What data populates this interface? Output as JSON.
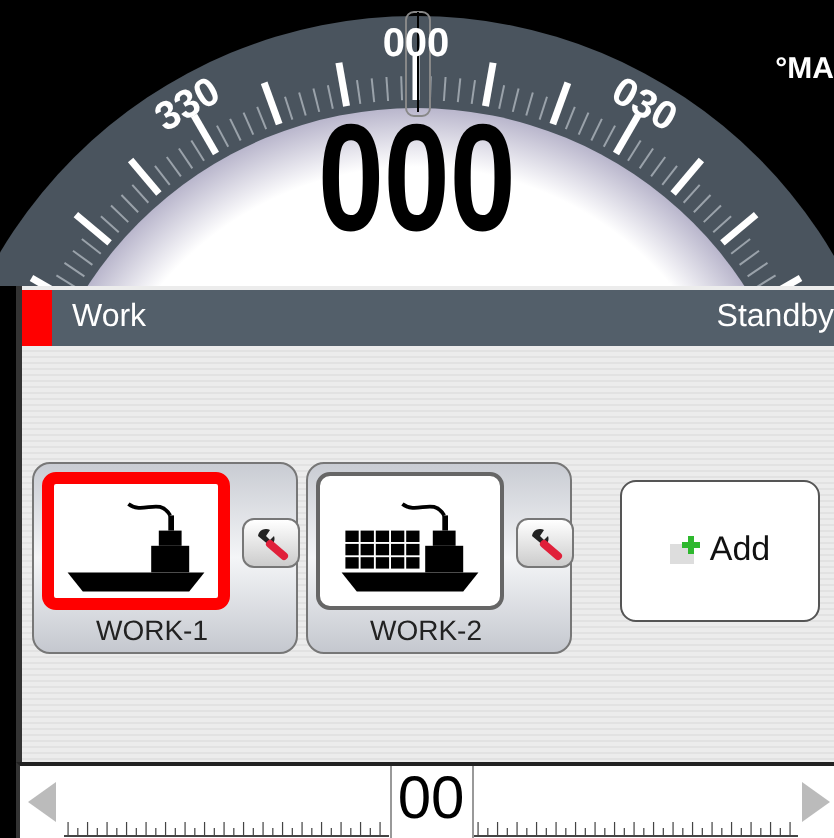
{
  "compass": {
    "labels": [
      "330",
      "000",
      "030"
    ],
    "heading": "000",
    "unit": "°MA"
  },
  "header": {
    "title": "Work",
    "status": "Standby"
  },
  "modes": [
    {
      "label": "WORK-1",
      "kind": "workboat",
      "selected": true
    },
    {
      "label": "WORK-2",
      "kind": "cargo",
      "selected": false
    }
  ],
  "add_button": {
    "label": "Add"
  },
  "rudder": {
    "value": "00"
  }
}
